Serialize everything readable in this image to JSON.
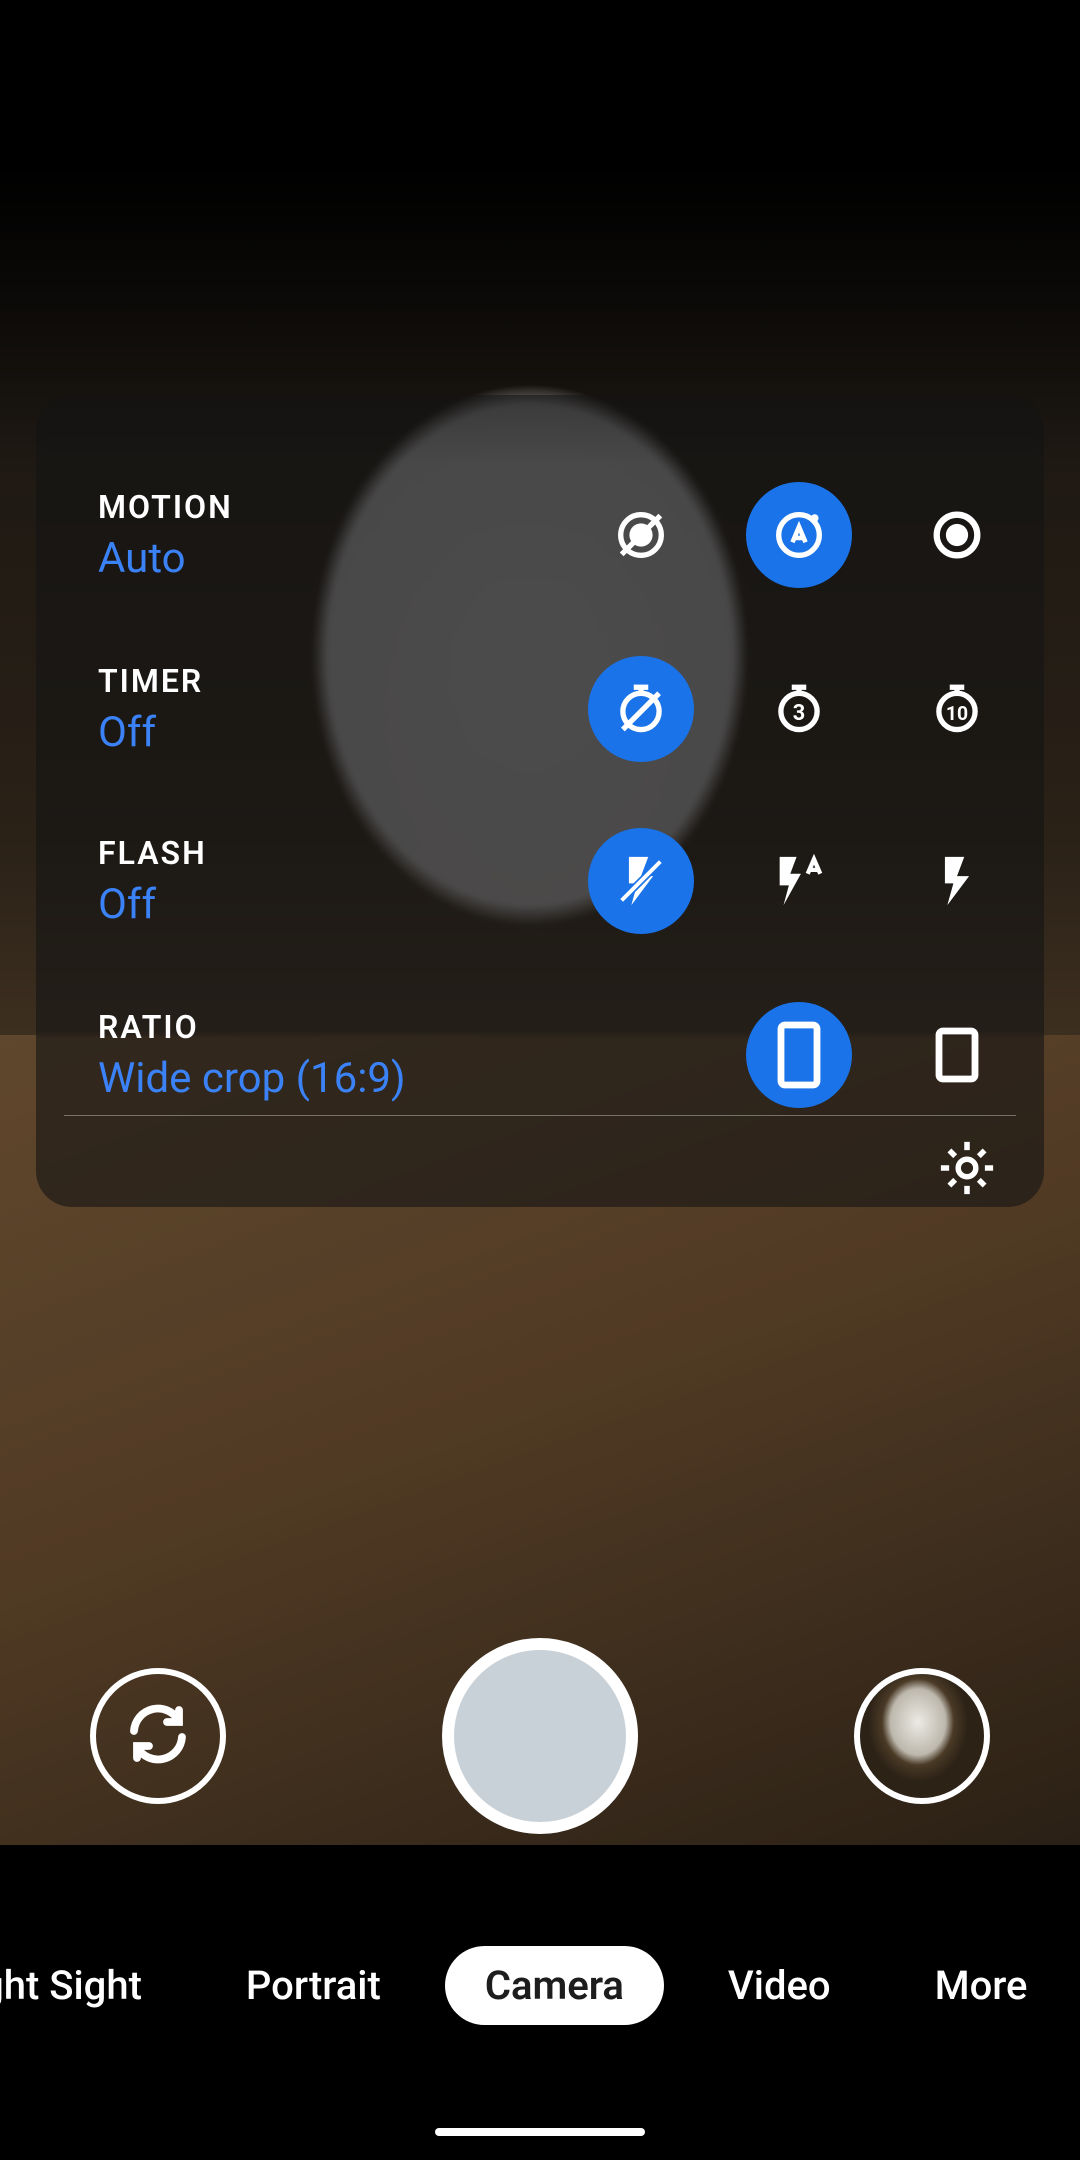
{
  "colors": {
    "accent": "#1a73e8",
    "value_text": "#3b82f6"
  },
  "panel": {
    "motion": {
      "label": "MOTION",
      "value": "Auto",
      "selected_index": 1,
      "options": [
        "off",
        "auto",
        "on"
      ]
    },
    "timer": {
      "label": "TIMER",
      "value": "Off",
      "selected_index": 0,
      "options": [
        "off",
        "3s",
        "10s"
      ]
    },
    "flash": {
      "label": "FLASH",
      "value": "Off",
      "selected_index": 0,
      "options": [
        "off",
        "auto",
        "on"
      ]
    },
    "ratio": {
      "label": "RATIO",
      "value": "Wide crop (16:9)",
      "selected_index": 0,
      "options": [
        "16:9",
        "4:3"
      ]
    }
  },
  "modes": {
    "items": [
      "Night Sight",
      "Portrait",
      "Camera",
      "Video",
      "More"
    ],
    "active_index": 2
  },
  "controls": {
    "switch_camera": "switch-camera",
    "shutter": "shutter",
    "last_photo_thumb": "gallery-thumbnail"
  }
}
